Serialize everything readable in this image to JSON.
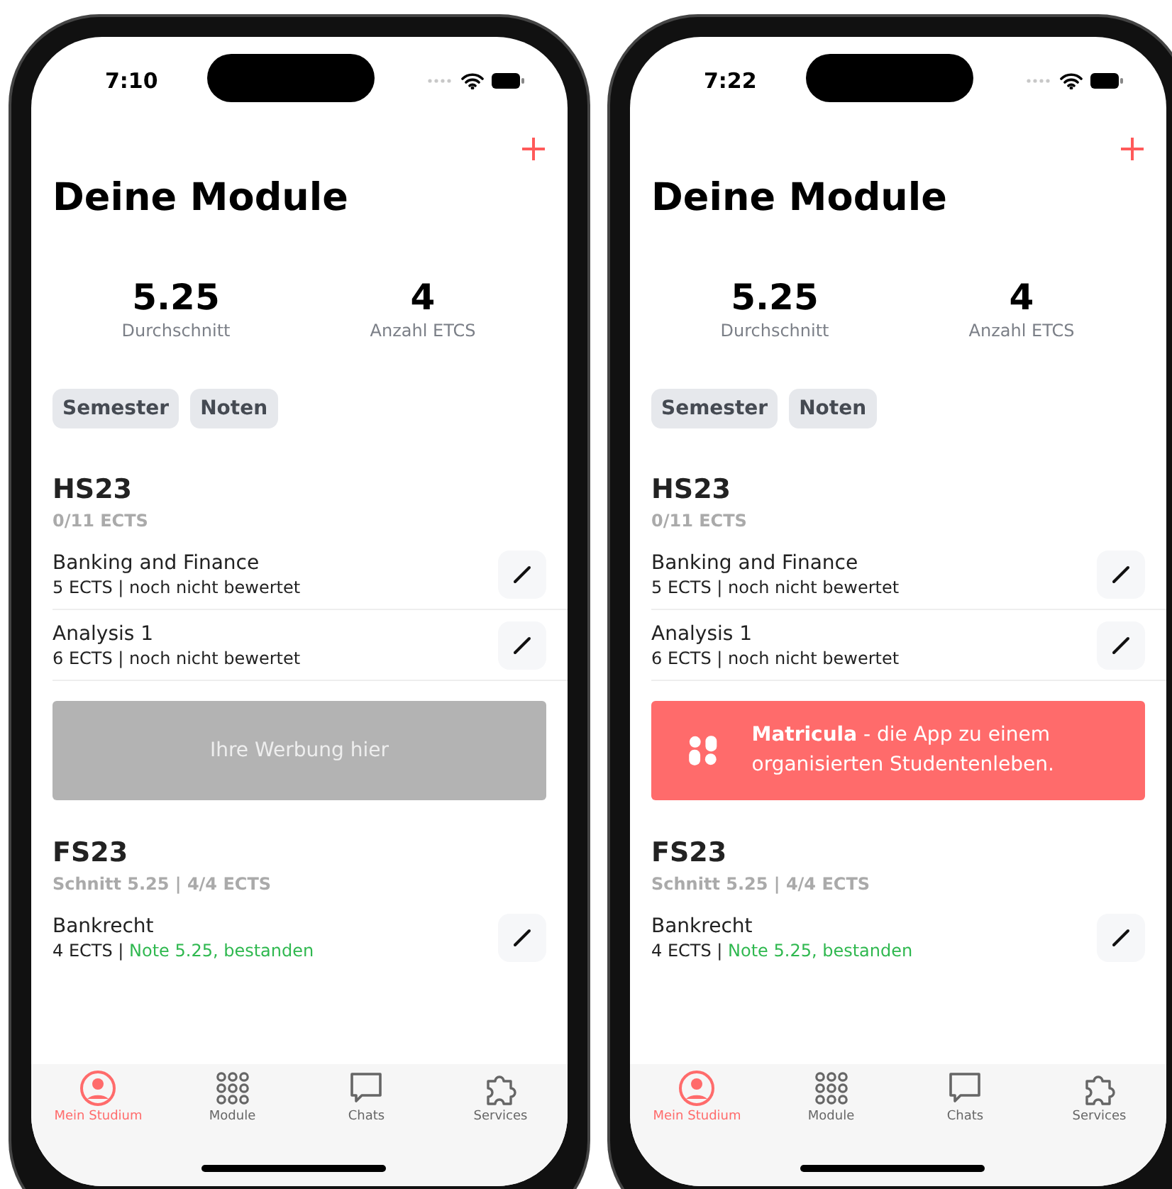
{
  "phones": [
    {
      "status_bar": {
        "time": "7:10"
      },
      "title": "Deine Module",
      "stats": [
        {
          "value": "5.25",
          "label": "Durchschnitt"
        },
        {
          "value": "4",
          "label": "Anzahl ETCS"
        }
      ],
      "filters": [
        {
          "label": "Semester"
        },
        {
          "label": "Noten"
        }
      ],
      "semesters": [
        {
          "name": "HS23",
          "summary": "0/11 ECTS",
          "modules": [
            {
              "name": "Banking and Finance",
              "ects": "5 ECTS |",
              "status": "noch nicht bewertet",
              "passed": false
            },
            {
              "name": "Analysis 1",
              "ects": "6 ECTS |",
              "status": "noch nicht bewertet",
              "passed": false
            }
          ],
          "ad": {
            "kind": "placeholder",
            "text": "Ihre Werbung hier"
          }
        },
        {
          "name": "FS23",
          "summary": "Schnitt 5.25 | 4/4 ECTS",
          "modules": [
            {
              "name": "Bankrecht",
              "ects": "4 ECTS |",
              "status": "Note 5.25, bestanden",
              "passed": true
            }
          ]
        }
      ],
      "tabs": [
        {
          "label": "Mein Studium",
          "selected": true
        },
        {
          "label": "Module",
          "selected": false
        },
        {
          "label": "Chats",
          "selected": false
        },
        {
          "label": "Services",
          "selected": false
        }
      ]
    },
    {
      "status_bar": {
        "time": "7:22"
      },
      "title": "Deine Module",
      "stats": [
        {
          "value": "5.25",
          "label": "Durchschnitt"
        },
        {
          "value": "4",
          "label": "Anzahl ETCS"
        }
      ],
      "filters": [
        {
          "label": "Semester"
        },
        {
          "label": "Noten"
        }
      ],
      "semesters": [
        {
          "name": "HS23",
          "summary": "0/11 ECTS",
          "modules": [
            {
              "name": "Banking and Finance",
              "ects": "5 ECTS |",
              "status": "noch nicht bewertet",
              "passed": false
            },
            {
              "name": "Analysis 1",
              "ects": "6 ECTS |",
              "status": "noch nicht bewertet",
              "passed": false
            }
          ],
          "ad": {
            "kind": "banner",
            "text": "**Matricula** - die App zu einem organisierten Studentenleben."
          }
        },
        {
          "name": "FS23",
          "summary": "Schnitt 5.25 | 4/4 ECTS",
          "modules": [
            {
              "name": "Bankrecht",
              "ects": "4 ECTS |",
              "status": "Note 5.25, bestanden",
              "passed": true
            }
          ]
        }
      ],
      "tabs": [
        {
          "label": "Mein Studium",
          "selected": true
        },
        {
          "label": "Module",
          "selected": false
        },
        {
          "label": "Chats",
          "selected": false
        },
        {
          "label": "Services",
          "selected": false
        }
      ]
    }
  ]
}
